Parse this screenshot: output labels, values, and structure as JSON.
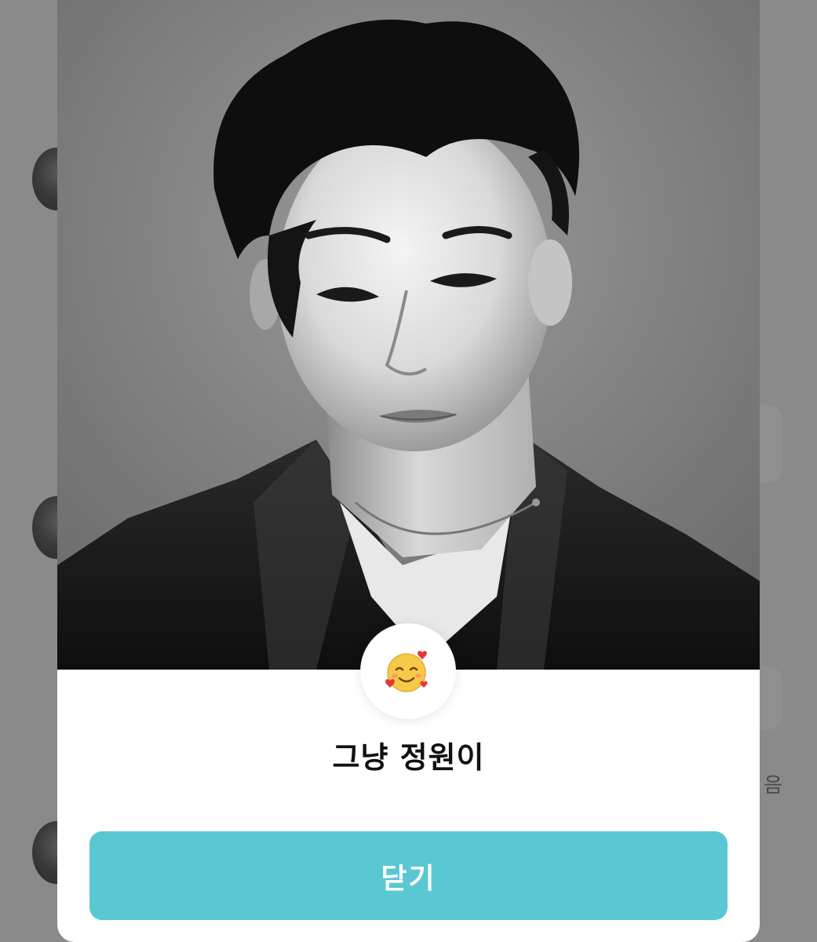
{
  "background": {
    "partial_text": "음",
    "dim_color": "#8a8a8a"
  },
  "profile": {
    "name": "그냥 정원이",
    "emoji_icon": "smiling-face-with-hearts-icon",
    "photo": "profile-photo"
  },
  "actions": {
    "close_label": "닫기"
  },
  "colors": {
    "accent": "#5ac8d2",
    "modal_bg": "#ffffff",
    "name_text": "#111111"
  }
}
